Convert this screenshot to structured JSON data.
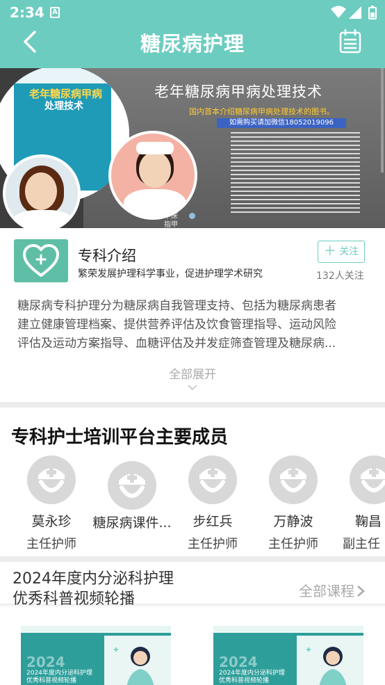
{
  "status_bar": {
    "time": "2:34",
    "notification_glyph": "A"
  },
  "app_bar": {
    "title": "糖尿病护理",
    "back_icon": "chevron-left-icon",
    "action_icon": "calendar-icon"
  },
  "banner": {
    "headline": "老年糖尿病甲病处理技术",
    "subline": "国内首本介绍糖尿病甲病处理技术的图书。",
    "buy_text": "如需购买请加微信18052019096",
    "book_title_line1": "老年糖尿病甲病",
    "book_title_line2": "处理技术",
    "diagram_labels": [
      "甲板",
      "甲床",
      "指甲"
    ]
  },
  "intro": {
    "title": "专科介绍",
    "subtitle": "繁荣发展护理科学事业，促进护理学术研究",
    "follow_label": "关注",
    "follow_count": "132人关注",
    "description_lines": [
      "糖尿病专科护理分为糖尿病自我管理支持、包括为糖尿病患者",
      "建立健康管理档案、提供营养评估及饮食管理指导、运动风险",
      "评估及运动方案指导、血糖评估及并发症筛查管理及糖尿病..."
    ],
    "expand_label": "全部展开"
  },
  "members": {
    "title": "专科护士培训平台主要成员",
    "items": [
      {
        "name": "莫永珍",
        "role": "主任护师"
      },
      {
        "name": "糖尿病课件...",
        "role": ""
      },
      {
        "name": "步红兵",
        "role": "主任护师"
      },
      {
        "name": "万静波",
        "role": "主任护师"
      },
      {
        "name": "鞠昌",
        "role": "副主任"
      }
    ]
  },
  "courses": {
    "title": "2024年度内分泌科护理优秀科普视频轮播",
    "all_label": "全部课程",
    "cards": [
      {
        "year": "2024",
        "title_line1": "2024年度内分泌科护理",
        "title_line2": "优秀科普视频轮播"
      },
      {
        "year": "2024",
        "title_line1": "2024年度内分泌科护理",
        "title_line2": "优秀科普视频轮播"
      }
    ]
  },
  "colors": {
    "primary": "#6dccc0",
    "logo": "#5fbfa6",
    "card": "#2d9e9a",
    "divider": "#ececec"
  }
}
